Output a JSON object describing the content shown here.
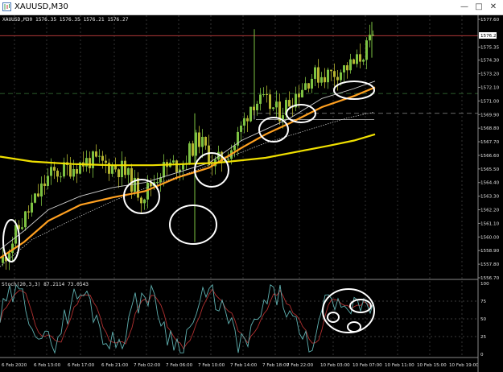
{
  "window": {
    "title": "XAUUSD,M30",
    "buttons": [
      "minimize",
      "maximize",
      "close"
    ]
  },
  "chart": {
    "main_info": "XAUUSD,M30  1576.35 1576.35 1576.21 1576.27",
    "indicator_info": "Stoch(20,3,3) 87.2114 73.0543",
    "current_price_label": "1576.27",
    "price_ticks": [
      "1577.60",
      "1575.35",
      "1574.30",
      "1573.20",
      "1572.10",
      "1571.00",
      "1569.90",
      "1568.80",
      "1567.70",
      "1566.60",
      "1565.50",
      "1564.40",
      "1563.30",
      "1562.20",
      "1561.10",
      "1560.00",
      "1558.90",
      "1557.80",
      "1556.70"
    ],
    "stoch_ticks": [
      "100",
      "75",
      "50",
      "25",
      "0"
    ],
    "time_ticks": [
      "6 Feb 2020",
      "6 Feb 13:00",
      "6 Feb 17:00",
      "6 Feb 21:00",
      "7 Feb 02:00",
      "7 Feb 06:00",
      "7 Feb 10:00",
      "7 Feb 14:00",
      "7 Feb 18:00",
      "7 Feb 22:00",
      "10 Feb 03:00",
      "10 Feb 07:00",
      "10 Feb 11:00",
      "10 Feb 15:00",
      "10 Feb 19:00"
    ]
  },
  "colors": {
    "background": "#000000",
    "bull_candle": "#7dc242",
    "bear_candle": "#b5b530",
    "ma_fast": "#ffffff",
    "ma_mid": "#ffa020",
    "ma_slow": "#f0e000",
    "stoch_main": "#5fb0b0",
    "stoch_signal": "#b03030",
    "price_line": "#b03a3a",
    "annotation": "#ffffff"
  }
}
